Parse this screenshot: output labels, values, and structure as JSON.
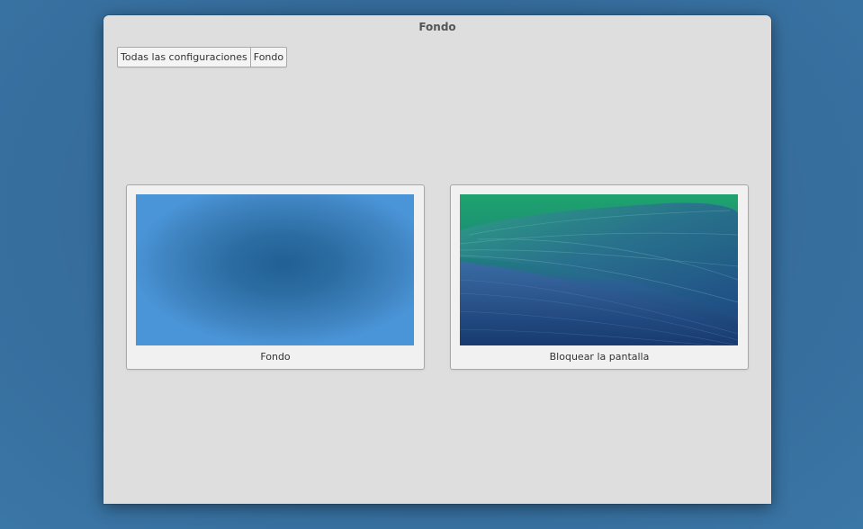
{
  "window": {
    "title": "Fondo"
  },
  "breadcrumb": {
    "items": [
      {
        "label": "Todas las configuraciones"
      },
      {
        "label": "Fondo"
      }
    ]
  },
  "wallpapers": {
    "desktop": {
      "label": "Fondo"
    },
    "lock_screen": {
      "label": "Bloquear la pantalla"
    }
  },
  "colors": {
    "desktop_background": "#356c9b",
    "window_background": "#dedede",
    "card_background": "#f1f1f1",
    "desktop_wallpaper_center": "#215f94",
    "desktop_wallpaper_edge": "#4a95d8",
    "lock_wallpaper_top": "#1fa36e",
    "lock_wallpaper_bottom": "#16376a"
  }
}
